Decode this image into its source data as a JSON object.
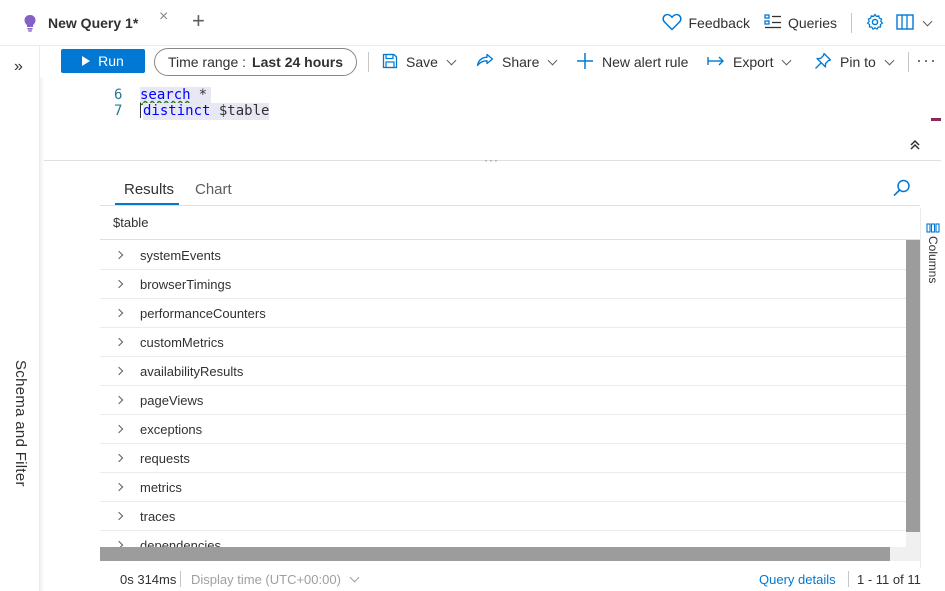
{
  "tab": {
    "title": "New Query 1*",
    "close": "×",
    "add": "+"
  },
  "header_actions": {
    "feedback": "Feedback",
    "queries": "Queries"
  },
  "toolbar": {
    "run": "Run",
    "time_range_label": "Time range :",
    "time_range_value": "Last 24 hours",
    "save": "Save",
    "share": "Share",
    "new_alert_rule": "New alert rule",
    "export": "Export",
    "pin_to": "Pin to",
    "more": "···"
  },
  "left_panel": {
    "expand": "»",
    "label": "Schema and Filter"
  },
  "editor": {
    "lines": [
      {
        "number": "6",
        "keyword": "search",
        "rest": "*"
      },
      {
        "number": "7",
        "keyword": "distinct",
        "rest": "$table"
      }
    ],
    "splitter": "···"
  },
  "results": {
    "tabs": [
      "Results",
      "Chart"
    ],
    "column_header": "$table",
    "rows": [
      "systemEvents",
      "browserTimings",
      "performanceCounters",
      "customMetrics",
      "availabilityResults",
      "pageViews",
      "exceptions",
      "requests",
      "metrics",
      "traces",
      "dependencies"
    ],
    "columns_label": "Columns"
  },
  "status": {
    "duration": "0s 314ms",
    "display_time": "Display time (UTC+00:00)",
    "query_details": "Query details",
    "count": "1 - 11 of 11"
  },
  "colors": {
    "accent": "#0078d4",
    "bulb": "#8661c5"
  }
}
